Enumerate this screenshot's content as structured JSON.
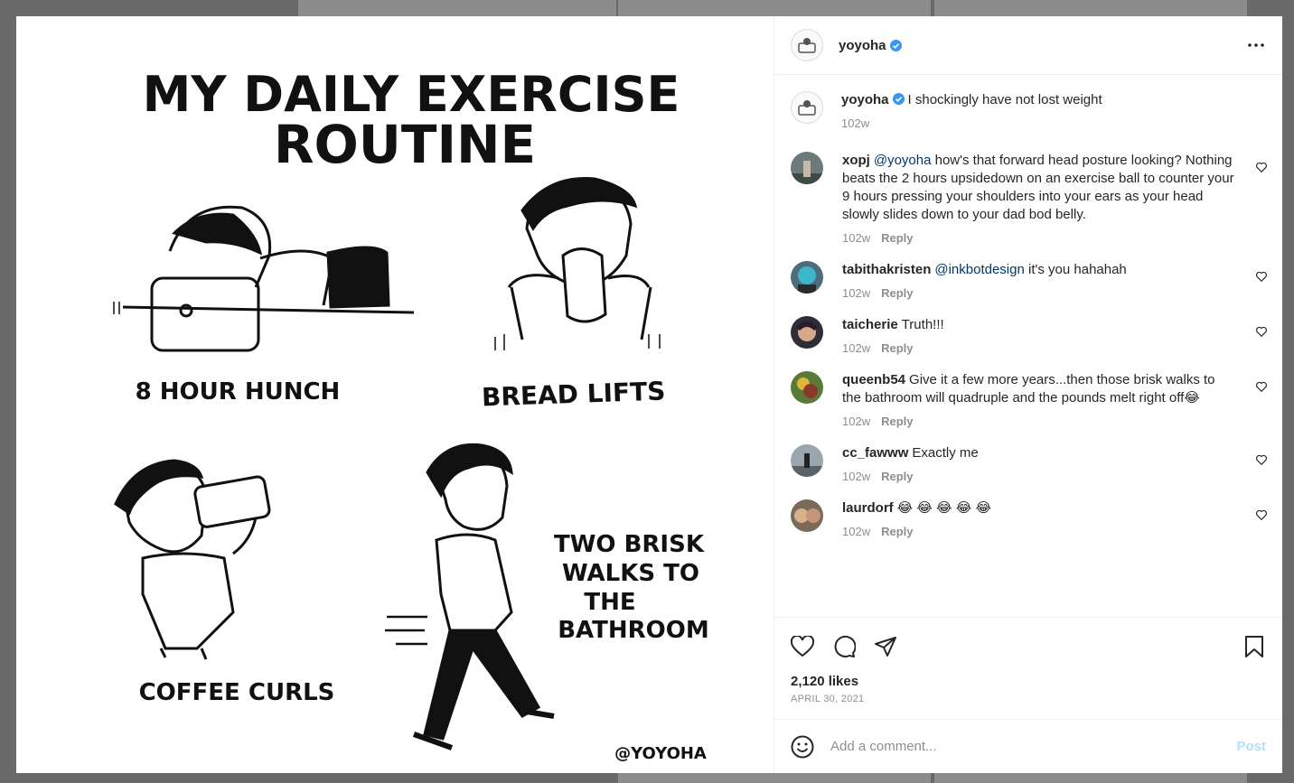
{
  "post": {
    "author": "yoyoha",
    "verified": true,
    "caption": "I shockingly have not lost weight",
    "caption_time": "102w",
    "likes": "2,120 likes",
    "date": "APRIL 30, 2021"
  },
  "comic": {
    "title_line1": "MY DAILY EXERCISE",
    "title_line2": "ROUTINE",
    "panel1": "8 HOUR HUNCH",
    "panel2": "BREAD LIFTS",
    "panel3": "COFFEE CURLS",
    "panel4_line1": "TWO BRISK",
    "panel4_line2": "WALKS TO",
    "panel4_line3": "THE",
    "panel4_line4": "BATHROOM",
    "signature": "@YOYOHA"
  },
  "comments": [
    {
      "user": "xopj",
      "mention": "@yoyoha",
      "text": "how's that forward head posture looking? Nothing beats the 2 hours upsidedown on an exercise ball to counter your 9 hours pressing your shoulders into your ears as your head slowly slides down to your dad bod belly.",
      "time": "102w",
      "reply": "Reply"
    },
    {
      "user": "tabithakristen",
      "mention": "@inkbotdesign",
      "text": "it's you hahahah",
      "time": "102w",
      "reply": "Reply"
    },
    {
      "user": "taicherie",
      "mention": "",
      "text": "Truth!!!",
      "time": "102w",
      "reply": "Reply"
    },
    {
      "user": "queenb54",
      "mention": "",
      "text": "Give it a few more years...then those brisk walks to the bathroom will quadruple and the pounds melt right off😂",
      "time": "102w",
      "reply": "Reply"
    },
    {
      "user": "cc_fawww",
      "mention": "",
      "text": "Exactly me",
      "time": "102w",
      "reply": "Reply"
    },
    {
      "user": "laurdorf",
      "mention": "",
      "text": "😂 😂 😂 😂 😂",
      "time": "102w",
      "reply": "Reply"
    }
  ],
  "composer": {
    "placeholder": "Add a comment...",
    "post_label": "Post"
  },
  "icons": {
    "more": "more-options-icon",
    "like": "heart-icon",
    "comment": "comment-icon",
    "share": "share-icon",
    "save": "bookmark-icon",
    "emoji": "emoji-icon"
  },
  "colors": {
    "verified": "#3897f0",
    "mention": "#00376b",
    "post_disabled": "#b2dffc"
  }
}
